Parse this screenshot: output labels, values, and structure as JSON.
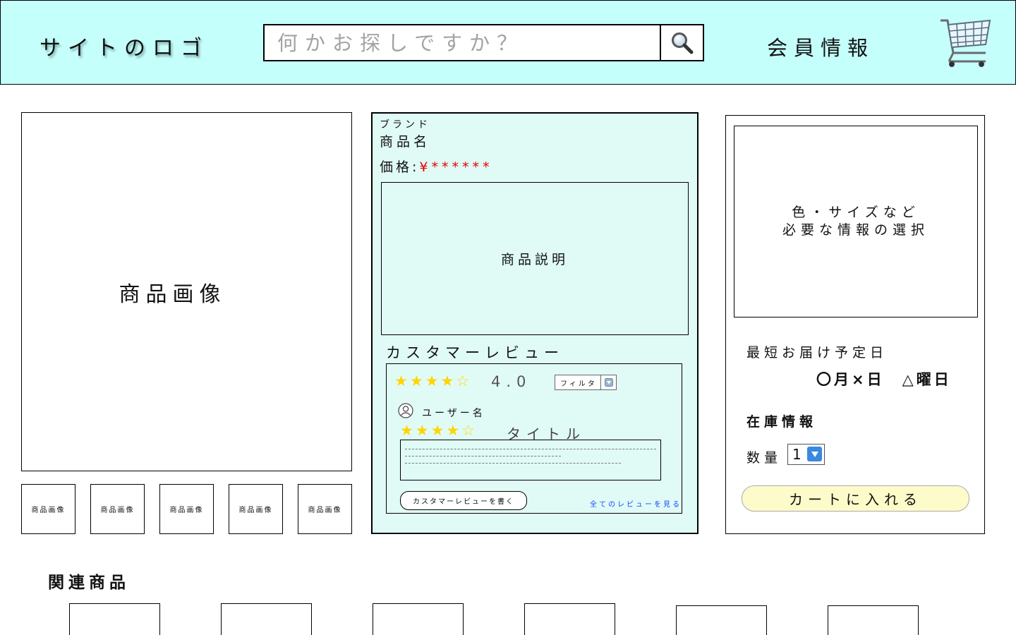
{
  "header": {
    "logo": "サイトのロゴ",
    "search_placeholder": "何かお探しですか？",
    "member_info": "会員情報",
    "cart_icon": "shopping-cart-icon",
    "search_icon": "magnifier-icon"
  },
  "gallery": {
    "main_image_label": "商品画像",
    "thumbnails": [
      "商品画像",
      "商品画像",
      "商品画像",
      "商品画像",
      "商品画像"
    ]
  },
  "product": {
    "brand": "ブランド",
    "name": "商品名",
    "price_label": "価格:",
    "price_value": "¥******",
    "description": "商品説明"
  },
  "reviews": {
    "heading": "カスタマーレビュー",
    "average_stars": "★★★★☆",
    "average_rating": "4.0",
    "filter_label": "フィルタ",
    "user_name": "ユーザー名",
    "review_stars": "★★★★☆",
    "review_title": "タイトル",
    "write_button": "カスタマーレビューを書く",
    "see_all_link": "全てのレビューを見る"
  },
  "purchase": {
    "options_line1": "色・サイズなど",
    "options_line2": "必要な情報の選択",
    "delivery_label": "最短お届け予定日",
    "delivery_date": "〇月×日　△曜日",
    "stock_label": "在庫情報",
    "quantity_label": "数量",
    "quantity_value": "1",
    "add_to_cart": "カートに入れる"
  },
  "related": {
    "heading": "関連商品",
    "item_count_visible": 6
  },
  "colors": {
    "header_bg": "#c4fffc",
    "info_panel_bg": "#e0fbf6",
    "price": "#e30000",
    "stars": "#ffd400",
    "cart_button_bg": "#fdfbc9",
    "link": "#1a44ff"
  }
}
